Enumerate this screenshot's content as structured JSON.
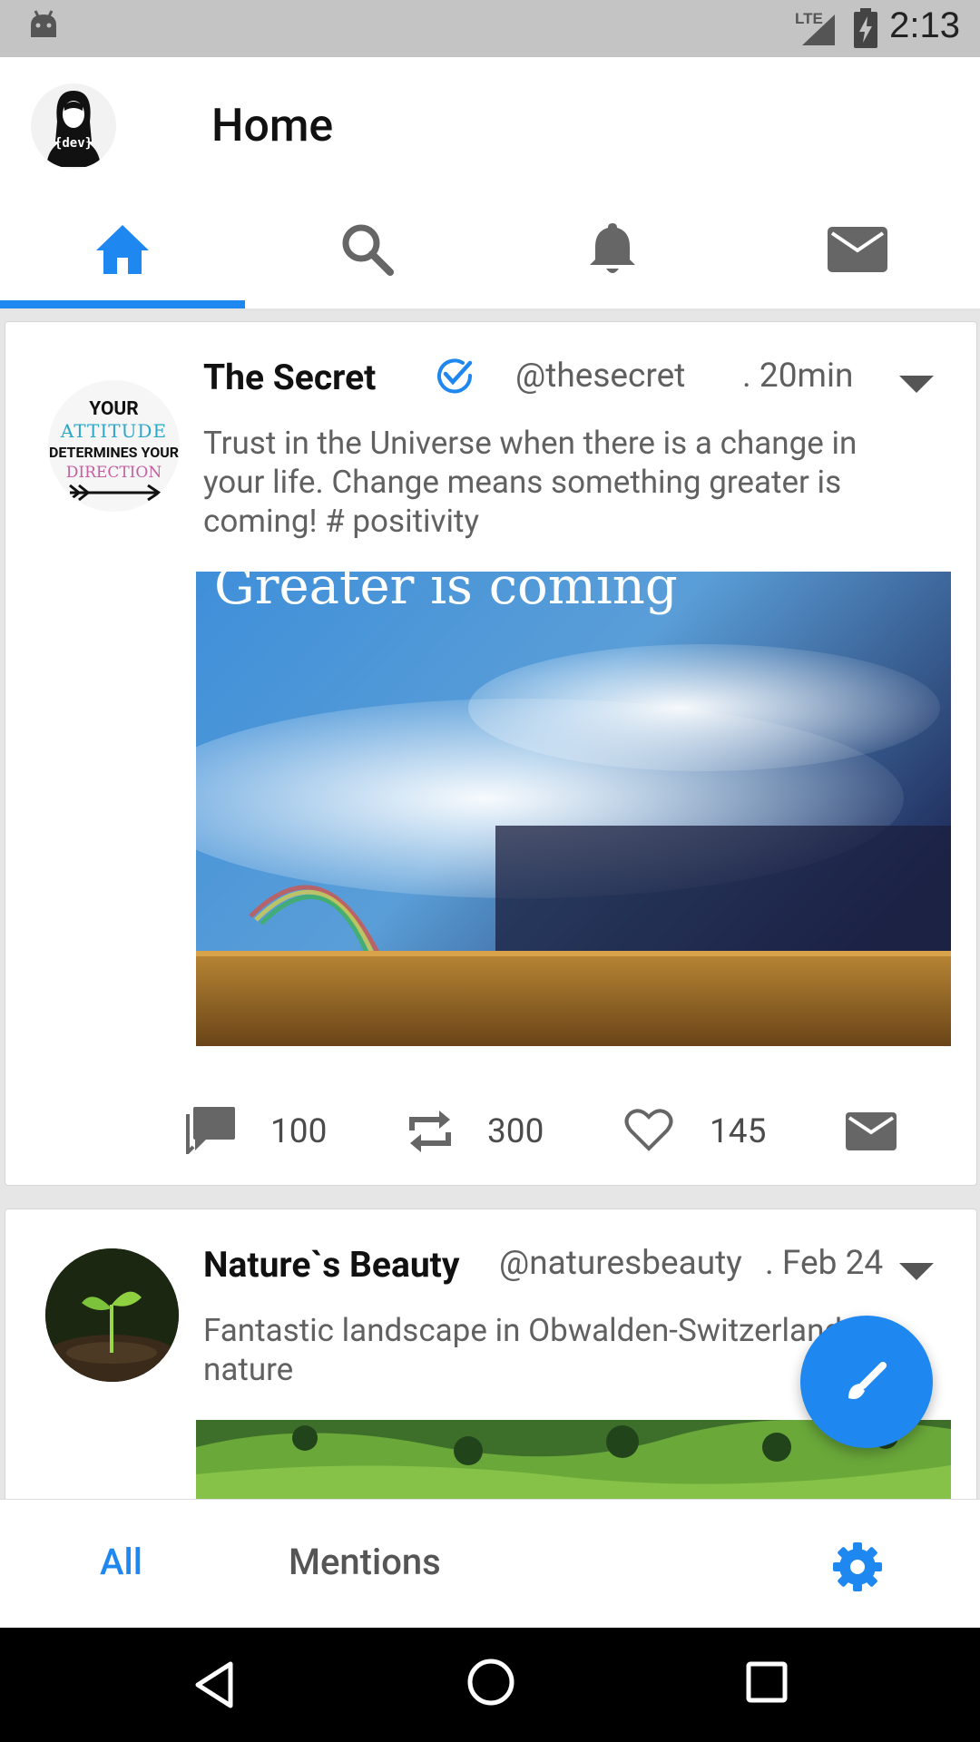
{
  "status": {
    "time": "2:13",
    "network": "LTE"
  },
  "header": {
    "title": "Home",
    "avatar_text": "{dev}"
  },
  "tabs": [
    {
      "icon": "home-icon",
      "active": true
    },
    {
      "icon": "search-icon",
      "active": false
    },
    {
      "icon": "bell-icon",
      "active": false
    },
    {
      "icon": "mail-icon",
      "active": false
    }
  ],
  "tweets": [
    {
      "author": "The Secret",
      "verified": true,
      "handle": "@thesecret",
      "time": ". 20min",
      "text": "Trust in the Universe when there is a change in your life. Change means something greater is coming! # positivity",
      "avatar_lines": [
        "YOUR",
        "ATTITUDE",
        "DETERMINES YOUR",
        "DIRECTION"
      ],
      "image_caption": "Greater is coming",
      "counts": {
        "comments": "100",
        "retweets": "300",
        "likes": "145"
      }
    },
    {
      "author": "Nature`s Beauty",
      "verified": false,
      "handle": "@naturesbeauty",
      "time": ". Feb 24",
      "text": "Fantastic landscape in Obwalden-Switzerland # nature"
    }
  ],
  "bottom_tabs": {
    "all": "All",
    "mentions": "Mentions"
  },
  "colors": {
    "accent": "#1f87f0",
    "status_bar": "#c4c4c4",
    "nav_bar": "#000000",
    "secondary_text": "#616161"
  }
}
